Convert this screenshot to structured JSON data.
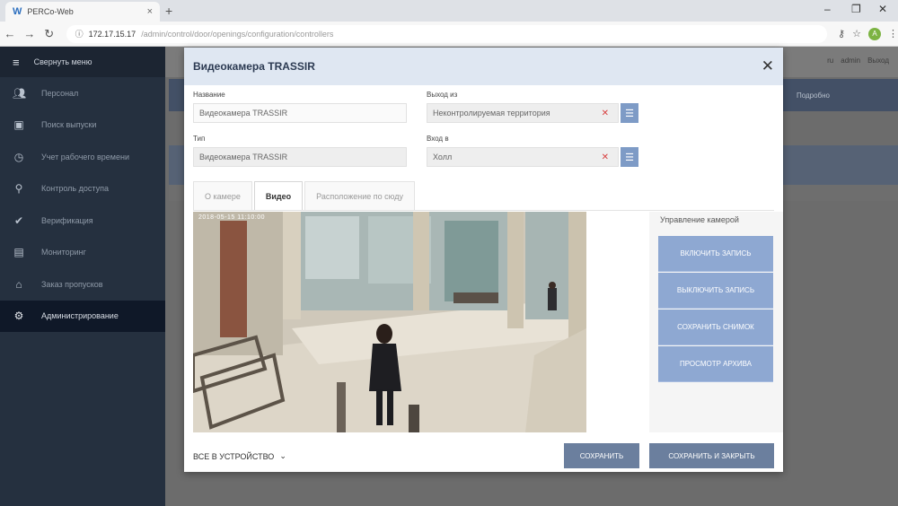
{
  "browser": {
    "tab_title": "PERCo-Web",
    "address_ip": "172.17.15.17",
    "address_path": "/admin/control/door/openings/configuration/controllers",
    "profile_initial": "A"
  },
  "sidebar": {
    "header": "Свернуть меню",
    "items": [
      {
        "label": "Персонал",
        "icon": "people-icon"
      },
      {
        "label": "Поиск выпуски",
        "icon": "briefcase-icon"
      },
      {
        "label": "Учет рабочего времени",
        "icon": "clock-doc-icon"
      },
      {
        "label": "Контроль доступа",
        "icon": "key-icon"
      },
      {
        "label": "Верификация",
        "icon": "verify-icon"
      },
      {
        "label": "Мониторинг",
        "icon": "chat-icon"
      },
      {
        "label": "Заказ пропусков",
        "icon": "pass-icon"
      },
      {
        "label": "Администрирование",
        "icon": "gear-icon",
        "active": true
      }
    ]
  },
  "app_topbar": {
    "right_items": [
      "ru",
      "admin",
      "Выход"
    ]
  },
  "bg_table": {
    "right_header": "Подробно"
  },
  "modal": {
    "title": "Видеокамера TRASSIR",
    "fields": {
      "name_label": "Название",
      "name_value": "Видеокамера TRASSIR",
      "type_label": "Тип",
      "type_value": "Видеокамера TRASSIR",
      "exit_from_label": "Выход из",
      "exit_from_value": "Неконтролируемая территория",
      "entry_to_label": "Вход в",
      "entry_to_value": "Холл"
    },
    "tabs": [
      {
        "label": "О камере",
        "active": false
      },
      {
        "label": "Видео",
        "active": true
      },
      {
        "label": "Расположение по сюду",
        "active": false
      }
    ],
    "video_timestamp": "2018-05-15  11:10:00",
    "control": {
      "title": "Управление камерой",
      "buttons": [
        "Включить запись",
        "Выключить запись",
        "Сохранить снимок",
        "Просмотр архива"
      ]
    },
    "footer": {
      "devices_link": "ВСЕ В УСТРОЙСТВО",
      "save": "Сохранить",
      "save_close": "Сохранить и закрыть"
    }
  }
}
